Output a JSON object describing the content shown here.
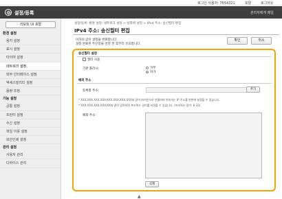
{
  "topbar": {
    "user": "로그인 사용자: 7654321",
    "home": "포탈",
    "logout": "로그아웃"
  },
  "header": {
    "title": "설정/등록",
    "admin": "관리자에게 메일"
  },
  "sidebar": {
    "portal_button": "리모트 UI 포탈",
    "items": [
      {
        "label": "환경 설정",
        "heading": true
      },
      {
        "label": "용지 설정"
      },
      {
        "label": "표시 설정"
      },
      {
        "label": "타이머 설정"
      },
      {
        "label": "네트워크 설정",
        "active": true
      },
      {
        "label": "외부 인터페이스 설정"
      },
      {
        "label": "액세스빌리티 설정"
      },
      {
        "label": "음량 조정"
      },
      {
        "label": "기능 설정",
        "heading": true
      },
      {
        "label": "공통 설정"
      },
      {
        "label": "프린터 설정"
      },
      {
        "label": "수신 설정"
      },
      {
        "label": "파일 이용 설정"
      },
      {
        "label": "보안인쇄 설정"
      },
      {
        "label": "관리 설정",
        "heading": true
      },
      {
        "label": "사용자 관리"
      },
      {
        "label": "디바이스 관리"
      }
    ]
  },
  "main": {
    "breadcrumb": "설정/등록: 환경 설정: 네트워크 설정 > 방화벽 설정 > IPv4 주소: 송신필터 편집",
    "title": "IPv4 주소: 송신필터 편집",
    "desc1": "이하의 값이 설정을 완료합니다.",
    "desc2": "설정 완료된 주인정을 반영 한 후부터 유효합니다.",
    "ok_button": "확인",
    "cancel_button": "취소",
    "section1": "송신필터 설정",
    "filter_checkbox_label": "필터 사용",
    "policy_label": "기본 폴리시:",
    "radio_deny": "거부",
    "radio_allow": "허가",
    "section2": "예외 주소",
    "register_label": "등록할 주소:",
    "add_button": "추가",
    "note1": "* XXX.XXX.XXX.XXX-XXX.XXX.XXX.XXX와 같이 하이픈으로 연결하여 연속하는 IP 주소를 한번에 설정할 수 있습니다.",
    "note2": "* XXX.XXX.XXX.XXX/XX와 같이 입력하면 프리픽스 길이를 지정할 수 있습니다. (프리픽스 길이: 0-32)",
    "exception_label": "예외 주소:",
    "delete_button": "삭제"
  }
}
